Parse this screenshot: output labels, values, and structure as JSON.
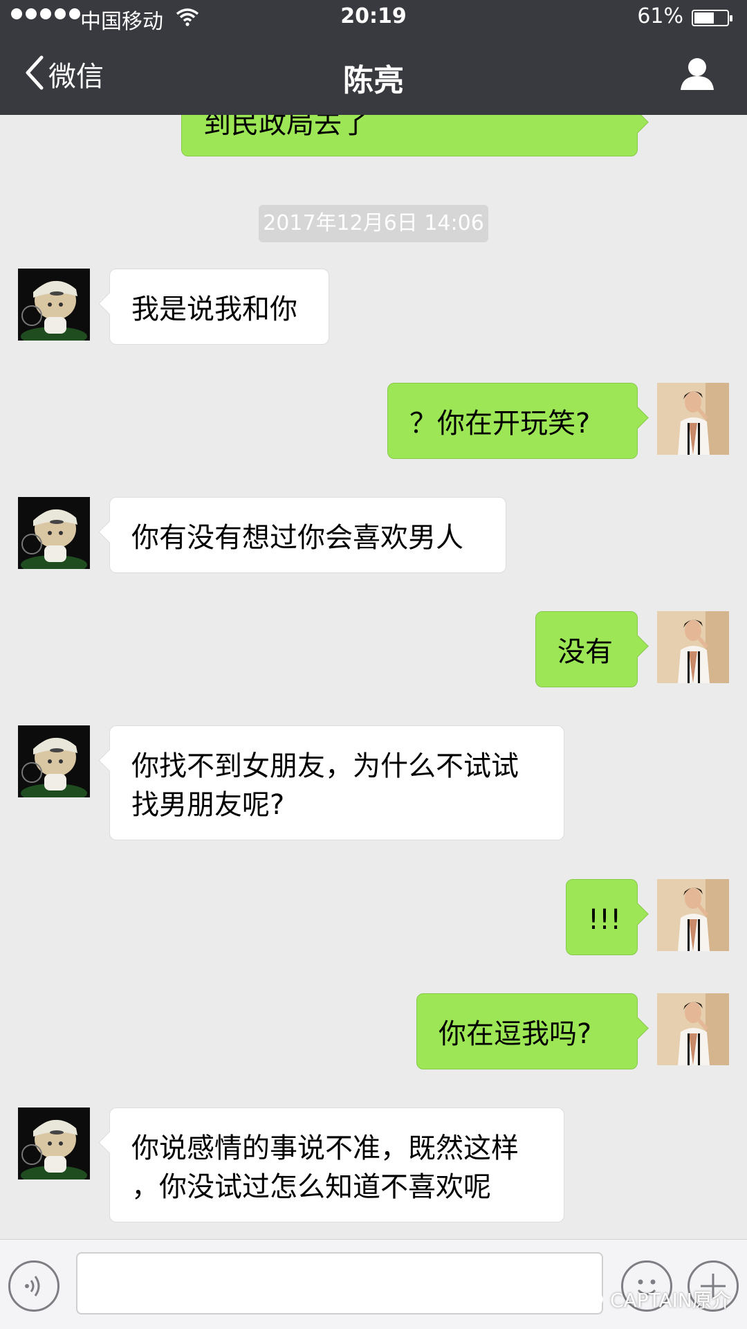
{
  "status_bar": {
    "carrier": "中国移动",
    "time": "20:19",
    "battery_percent": "61%",
    "battery_level": 0.61,
    "icons": [
      "signal-dots-icon",
      "wifi-icon",
      "battery-icon"
    ]
  },
  "nav": {
    "back_label": "微信",
    "title": "陈亮",
    "back_icon": "chevron-left-icon",
    "profile_icon": "person-icon"
  },
  "chat": {
    "previous_message_fragment": "到民政局去了",
    "timestamp": "2017年12月6日 14:06",
    "messages": [
      {
        "side": "in",
        "text": "我是说我和你"
      },
      {
        "side": "out",
        "text": "？你在开玩笑?"
      },
      {
        "side": "in",
        "text": "你有没有想过你会喜欢男人"
      },
      {
        "side": "out",
        "text": "没有"
      },
      {
        "side": "in",
        "text": "你找不到女朋友，为什么不试试\n找男朋友呢?"
      },
      {
        "side": "out",
        "text": "!!!"
      },
      {
        "side": "out",
        "text": "你在逗我吗?"
      },
      {
        "side": "in",
        "text": "你说感情的事说不准，既然这样\n，你没试过怎么知道不喜欢呢"
      }
    ]
  },
  "input_bar": {
    "text_value": "",
    "icons": [
      "voice-icon",
      "emoji-icon",
      "plus-icon"
    ]
  },
  "watermark": {
    "text": "CAPTAIN原介",
    "icon": "wechat-logo-icon"
  },
  "colors": {
    "header_bg": "#393a3f",
    "chat_bg": "#ebebeb",
    "outgoing_bubble": "#9de655",
    "incoming_bubble": "#ffffff"
  }
}
